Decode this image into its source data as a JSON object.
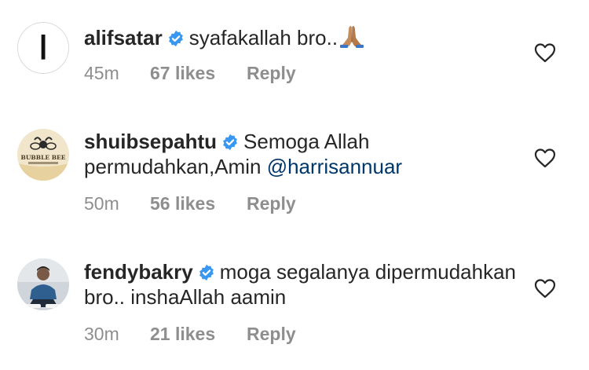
{
  "comments": [
    {
      "username": "alifsatar",
      "text": "syafakallah bro..",
      "emoji": "folded-hands",
      "mention": "",
      "time": "45m",
      "likes": "67 likes",
      "reply": "Reply",
      "avatar_glyph": "ا"
    },
    {
      "username": "shuibsepahtu",
      "text": "Semoga Allah permudahkan,Amin",
      "mention": "@harrisannuar",
      "time": "50m",
      "likes": "56 likes",
      "reply": "Reply",
      "avatar_text": "BUBBLE BEE"
    },
    {
      "username": "fendybakry",
      "text": "moga segalanya dipermudahkan bro.. inshaAllah aamin",
      "mention": "",
      "time": "30m",
      "likes": "21 likes",
      "reply": "Reply"
    }
  ],
  "colors": {
    "text": "#262626",
    "meta": "#8e8e8e",
    "mention": "#00376b",
    "verified": "#3897f0"
  }
}
